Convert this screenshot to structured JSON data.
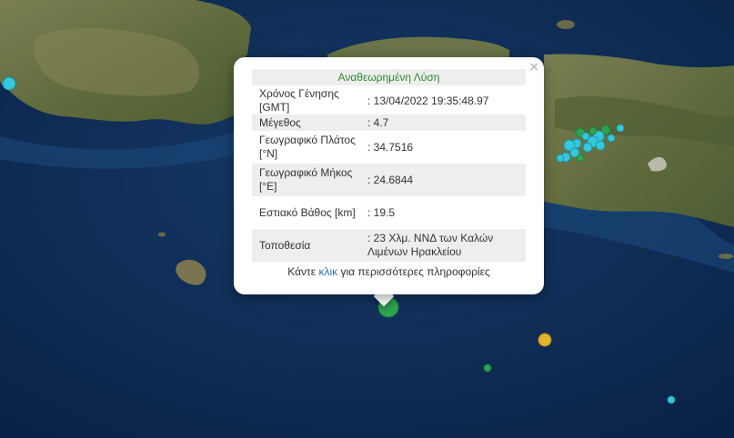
{
  "popup": {
    "title": "Αναθεωρημένη Λύση",
    "close_symbol": "×",
    "rows": [
      {
        "label": "Χρόνος Γένησης [GMT]",
        "value": ": 13/04/2022 19:35:48.97"
      },
      {
        "label": "Μέγεθος",
        "value": ": 4.7"
      },
      {
        "label": "Γεωγραφικό Πλάτος [°N]",
        "value": ": 34.7516"
      },
      {
        "label": "Γεωγραφικό Μήκος [°E]",
        "value": ": 24.6844"
      },
      {
        "label": "Εστιακό Βάθος [km]",
        "value": ": 19.5"
      },
      {
        "label": "Τοποθεσία",
        "value": ": 23 Χλμ. ΝΝΔ των Καλών Λιμένων Ηρακλείου"
      }
    ],
    "more_prefix": "Κάντε ",
    "more_link": "κλικ",
    "more_suffix": " για περισσότερες πληροφορίες"
  },
  "map": {
    "sea_color": "#0c2a52",
    "land_color": "#6f7547",
    "event_colors": {
      "recent": "#34c7dd",
      "selected": "#2fa352",
      "medium": "#e2b430"
    }
  }
}
